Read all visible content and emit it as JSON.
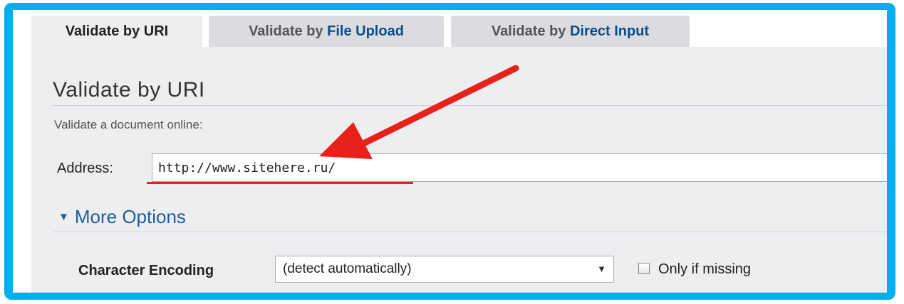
{
  "tabs": [
    {
      "prefix": "Validate by URI",
      "accent": "",
      "active": true
    },
    {
      "prefix": "Validate by ",
      "accent": "File Upload",
      "active": false
    },
    {
      "prefix": "Validate by ",
      "accent": "Direct Input",
      "active": false
    }
  ],
  "main": {
    "title": "Validate by URI",
    "subtitle": "Validate a document online:",
    "address_label": "Address:",
    "address_value": "http://www.sitehere.ru/"
  },
  "options": {
    "toggle_label": "More Options",
    "encoding_label": "Character Encoding",
    "encoding_value": "(detect automatically)",
    "only_if_missing_label": "Only if missing",
    "only_if_missing_checked": false
  },
  "annotation": {
    "arrow_color": "#E8211B",
    "frame_color": "#00AEEF"
  }
}
